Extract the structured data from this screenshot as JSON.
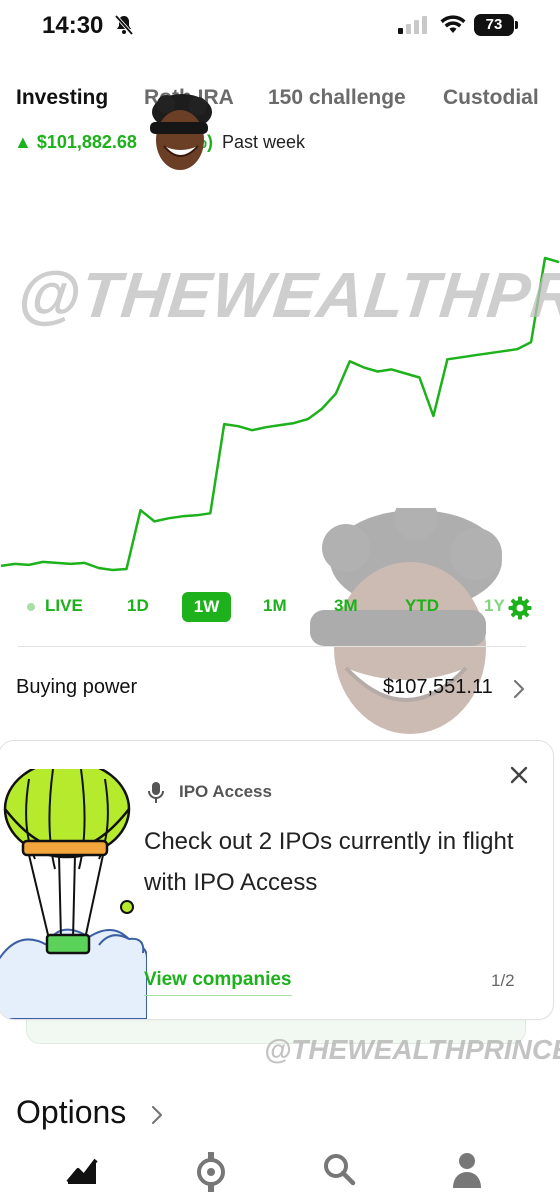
{
  "status_bar": {
    "time": "14:30",
    "battery": "73"
  },
  "tabs": [
    {
      "label": "Investing"
    },
    {
      "label": "Roth IRA"
    },
    {
      "label": "150 challenge"
    },
    {
      "label": "Custodial"
    }
  ],
  "performance": {
    "arrow": "▲",
    "amount": "$101,882.68",
    "percent_visible": "%)",
    "period": "Past week"
  },
  "watermark": {
    "big": "@THEWEALTHPRINCE",
    "small": "@THEWEALTHPRINCE"
  },
  "ranges": [
    {
      "label": "LIVE"
    },
    {
      "label": "1D"
    },
    {
      "label": "1W"
    },
    {
      "label": "1M"
    },
    {
      "label": "3M"
    },
    {
      "label": "YTD"
    },
    {
      "label": "1Y"
    }
  ],
  "buying_power": {
    "label": "Buying power",
    "value": "$107,551.11"
  },
  "ipo_card": {
    "kicker": "IPO Access",
    "title": "Check out 2 IPOs currently in flight with IPO Access",
    "link": "View companies",
    "page": "1/2"
  },
  "options": {
    "title": "Options"
  },
  "colors": {
    "accent": "#1db11b",
    "text": "#111111",
    "muted": "#6b6b6b"
  },
  "chart_data": {
    "type": "line",
    "series": [
      {
        "values": [
          0.0,
          0.02,
          0.01,
          0.04,
          0.03,
          0.02,
          0.03,
          -0.02,
          -0.04,
          -0.03,
          0.55,
          0.44,
          0.47,
          0.49,
          0.5,
          0.52,
          1.4,
          1.38,
          1.34,
          1.37,
          1.39,
          1.41,
          1.45,
          1.55,
          1.7,
          2.02,
          1.96,
          1.92,
          1.94,
          1.9,
          1.86,
          1.48,
          2.04,
          2.06,
          2.08,
          2.1,
          2.12,
          2.14,
          2.21,
          3.04,
          3.0
        ]
      }
    ]
  },
  "icons": [
    "bell-slash-icon",
    "signal-icon",
    "wifi-icon",
    "gear-icon",
    "chevron-right-icon",
    "mic-icon",
    "close-icon",
    "chart-icon",
    "crypto-icon",
    "search-icon",
    "person-icon"
  ]
}
